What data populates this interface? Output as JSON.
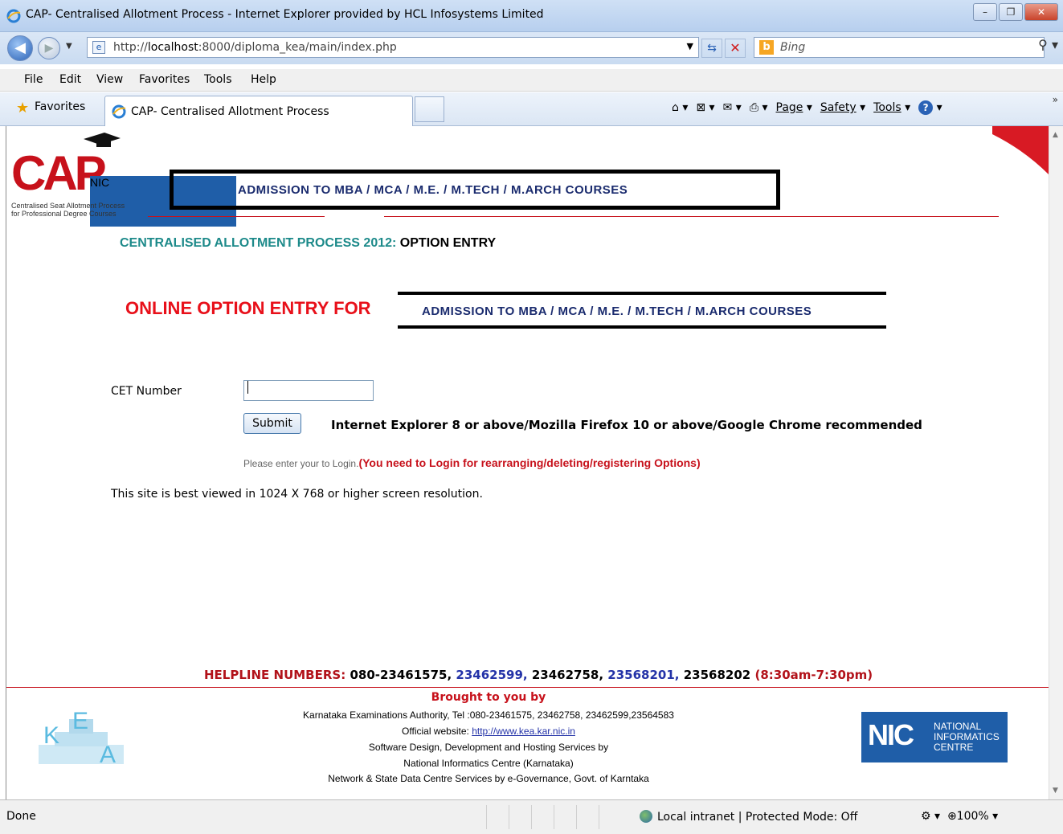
{
  "window": {
    "title": "CAP- Centralised Allotment Process - Internet Explorer provided by HCL Infosystems Limited",
    "buttons": {
      "minimize": "–",
      "maximize": "❐",
      "close": "✕"
    }
  },
  "address_bar": {
    "url_prefix": "http://",
    "url_host": "localhost",
    "url_rest": ":8000/diploma_kea/main/index.php"
  },
  "search": {
    "provider": "Bing"
  },
  "menu": {
    "file": "File",
    "edit": "Edit",
    "view": "View",
    "favorites": "Favorites",
    "tools": "Tools",
    "help": "Help"
  },
  "favorites_bar": {
    "favorites_label": "Favorites",
    "tab_title": "CAP- Centralised Allotment Process",
    "commands": {
      "page": "Page",
      "safety": "Safety",
      "tools": "Tools"
    }
  },
  "page": {
    "logo": {
      "cap": "CAP",
      "nic": "NIC",
      "subtitle_1": "Centralised Seat Allotment Process",
      "subtitle_2": "for Professional Degree Courses"
    },
    "header_box": "ADMISSION TO MBA / MCA / M.E. / M.TECH / M.ARCH COURSES",
    "subtitle_prefix": "CENTRALISED ALLOTMENT PROCESS 2012:",
    "subtitle_suffix": "OPTION ENTRY",
    "online_option_label": "ONLINE OPTION ENTRY FOR",
    "online_option_box": "ADMISSION TO MBA / MCA / M.E. / M.TECH / M.ARCH COURSES",
    "cet_label": "CET Number",
    "cet_value": "",
    "submit_label": "Submit",
    "browser_note": "Internet Explorer 8 or above/Mozilla Firefox 10 or above/Google Chrome recommended",
    "login_note_prefix": "Please enter your to Login.",
    "login_note_red": "(You need to Login for rearranging/deleting/registering Options)",
    "best_view": "This site is best viewed in 1024 X 768 or higher screen resolution.",
    "helpline": {
      "label": "HELPLINE NUMBERS:",
      "n1": "080-23461575,",
      "n2": "23462599,",
      "n3": "23462758,",
      "n4": "23568201,",
      "n5": "23568202",
      "hours": "(8:30am-7:30pm)"
    },
    "footer": {
      "brought": "Brought to you by",
      "line1": "Karnataka Examinations Authority, Tel :080-23461575, 23462758, 23462599,23564583",
      "website_label": "Official website:",
      "website_link": "http://www.kea.kar.nic.in",
      "line3": "Software Design, Development and Hosting Services by",
      "line4": "National Informatics Centre (Karnataka)",
      "line5": "Network & State Data Centre Services by e-Governance, Govt. of Karntaka",
      "kea_logo_text": "KEA",
      "nic_big": "NIC",
      "nic_line1": "NATIONAL",
      "nic_line2": "INFORMATICS",
      "nic_line3": "CENTRE"
    }
  },
  "status_bar": {
    "status": "Done",
    "zone": "Local intranet | Protected Mode: Off",
    "zoom": "100%"
  }
}
